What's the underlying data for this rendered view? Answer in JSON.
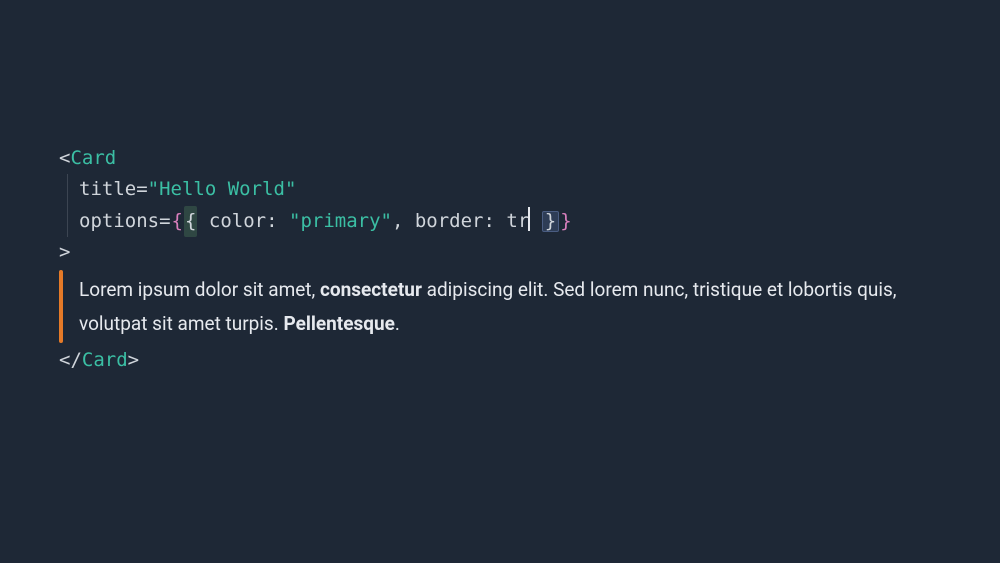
{
  "code": {
    "open_bracket": "<",
    "tag_name": "Card",
    "title_attr": "title",
    "eq": "=",
    "quote": "\"",
    "title_value": "Hello World",
    "options_attr": "options",
    "brace_outer_open": "{",
    "brace_inner_open": "{",
    "color_key": "color",
    "colon_sp": ": ",
    "color_value": "primary",
    "comma_sp": ", ",
    "border_key": "border",
    "border_partial": "tr",
    "brace_inner_close": "}",
    "brace_outer_close": "}",
    "gt": ">",
    "close_open": "</",
    "close_gt": ">"
  },
  "prose": {
    "t1": "Lorem ipsum dolor sit amet, ",
    "b1": "consectetur",
    "t2": " adipiscing elit. Sed lorem nunc, tristique et lobortis quis, volutpat sit amet turpis. ",
    "b2": "Pellentesque",
    "t3": "."
  }
}
